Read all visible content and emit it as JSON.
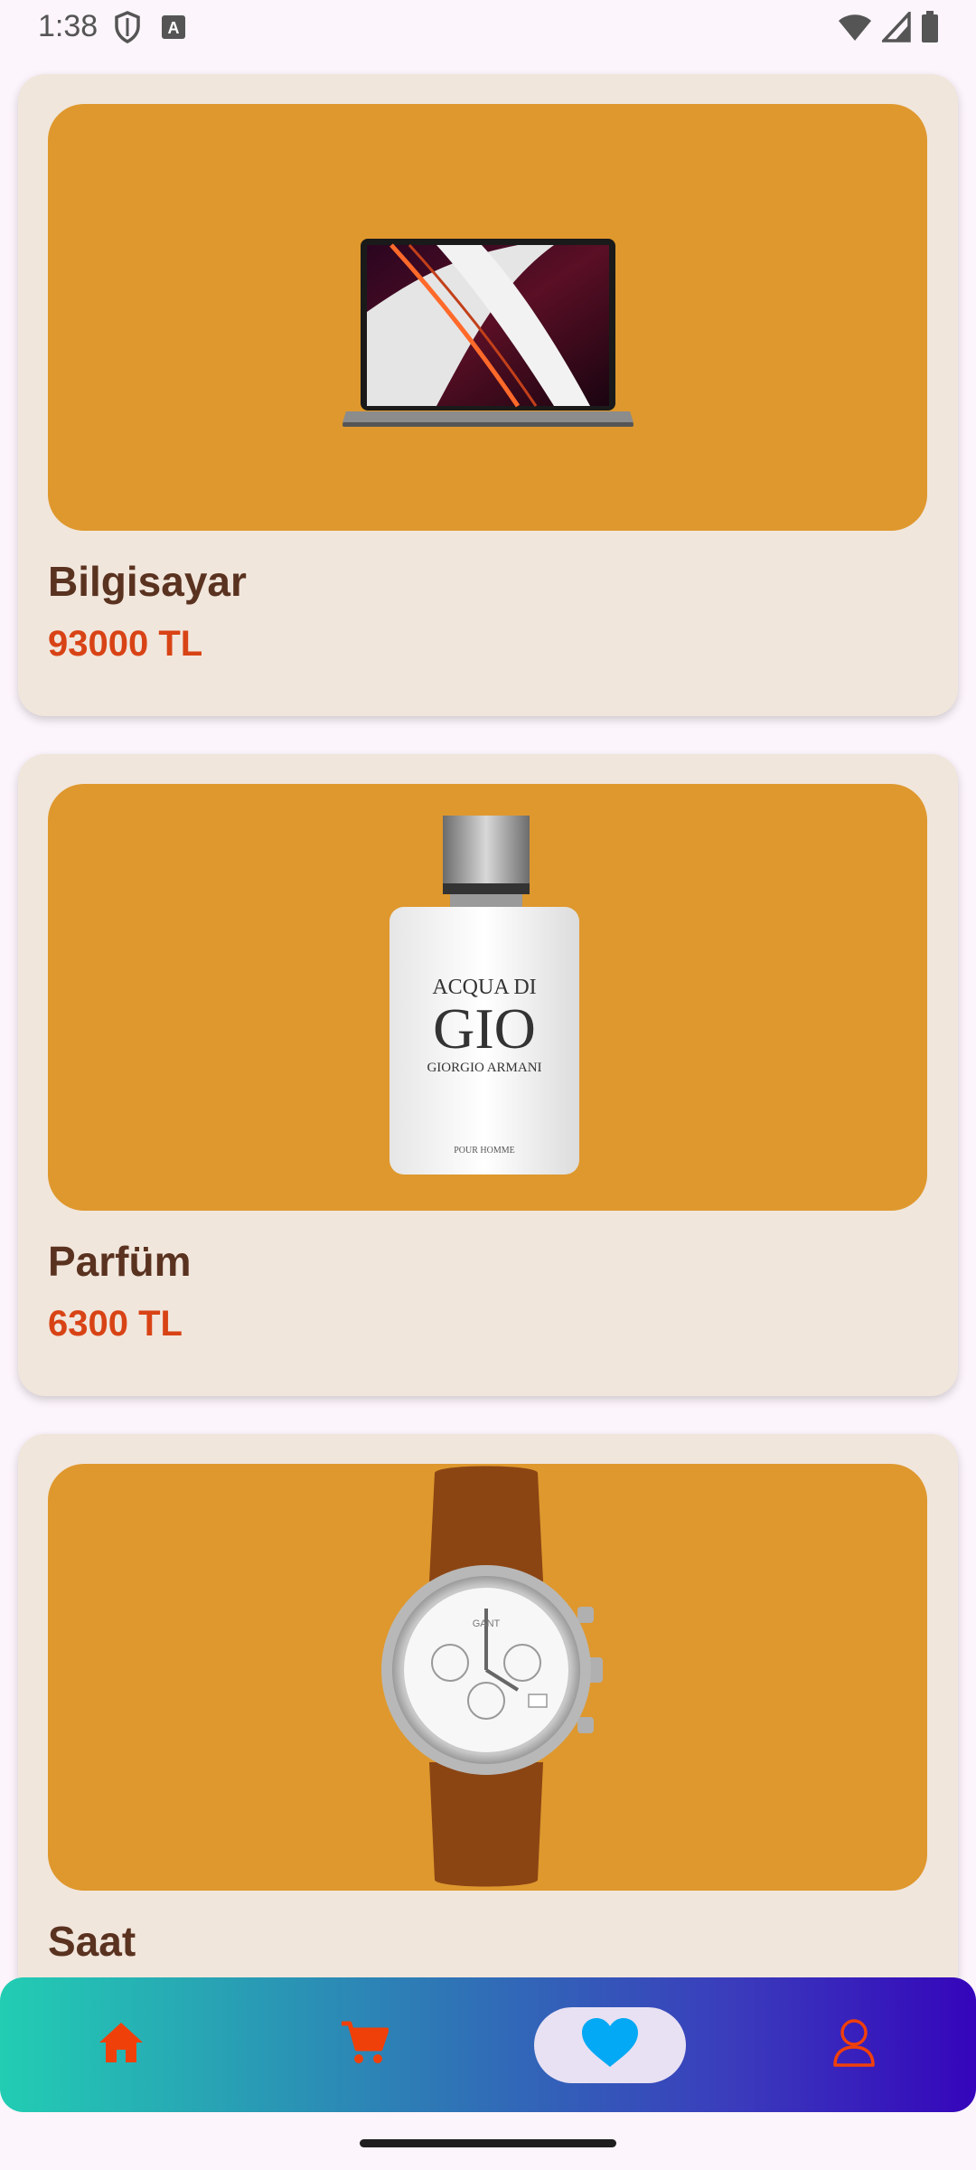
{
  "status_bar": {
    "time": "1:38",
    "left_icons": [
      "shield-icon",
      "font-icon"
    ],
    "right_icons": [
      "wifi-icon",
      "cellular-icon",
      "battery-icon"
    ]
  },
  "products": [
    {
      "name": "Bilgisayar",
      "price": "93000 TL",
      "image": "laptop"
    },
    {
      "name": "Parfüm",
      "price": "6300 TL",
      "image": "perfume-bottle"
    },
    {
      "name": "Saat",
      "price": "",
      "image": "wristwatch"
    }
  ],
  "perfume_label": {
    "line1": "ACQUA DI",
    "line2": "GIO",
    "line3": "GIORGIO ARMANI",
    "line4": "POUR HOMME"
  },
  "watch_brand": "GANT",
  "bottom_nav": {
    "items": [
      {
        "id": "home",
        "icon": "home-icon",
        "active": false
      },
      {
        "id": "cart",
        "icon": "cart-icon",
        "active": false
      },
      {
        "id": "favorites",
        "icon": "heart-icon",
        "active": true
      },
      {
        "id": "profile",
        "icon": "user-icon",
        "active": false
      }
    ]
  },
  "colors": {
    "card_bg": "#f1e6dc",
    "image_bg": "#df982d",
    "name_text": "#5a3220",
    "price_text": "#d84315",
    "nav_icon": "#f0400a",
    "nav_active_icon": "#03a9f4",
    "nav_gradient_start": "#22cdb3",
    "nav_gradient_end": "#3505bb"
  }
}
